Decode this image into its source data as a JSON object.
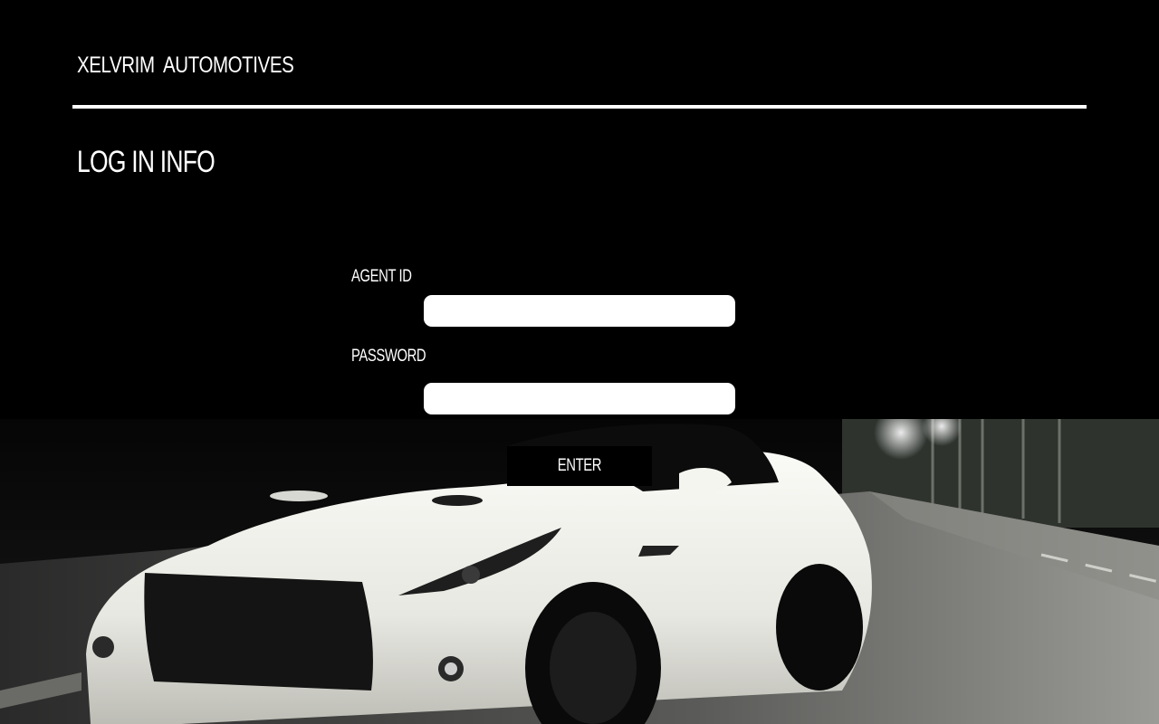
{
  "header": {
    "brand": "XELVRIM  AUTOMOTIVES"
  },
  "main": {
    "title": "LOG IN INFO"
  },
  "form": {
    "agent_id": {
      "label": "AGENT ID",
      "value": "",
      "placeholder": ""
    },
    "password": {
      "label": "PASSWORD",
      "value": "",
      "placeholder": ""
    },
    "enter_label": "ENTER"
  },
  "colors": {
    "background": "#000000",
    "text": "#ffffff",
    "input_background": "#ffffff",
    "car": "#f2f2ee"
  },
  "background_image": {
    "subject": "white-sports-car-on-night-road"
  }
}
